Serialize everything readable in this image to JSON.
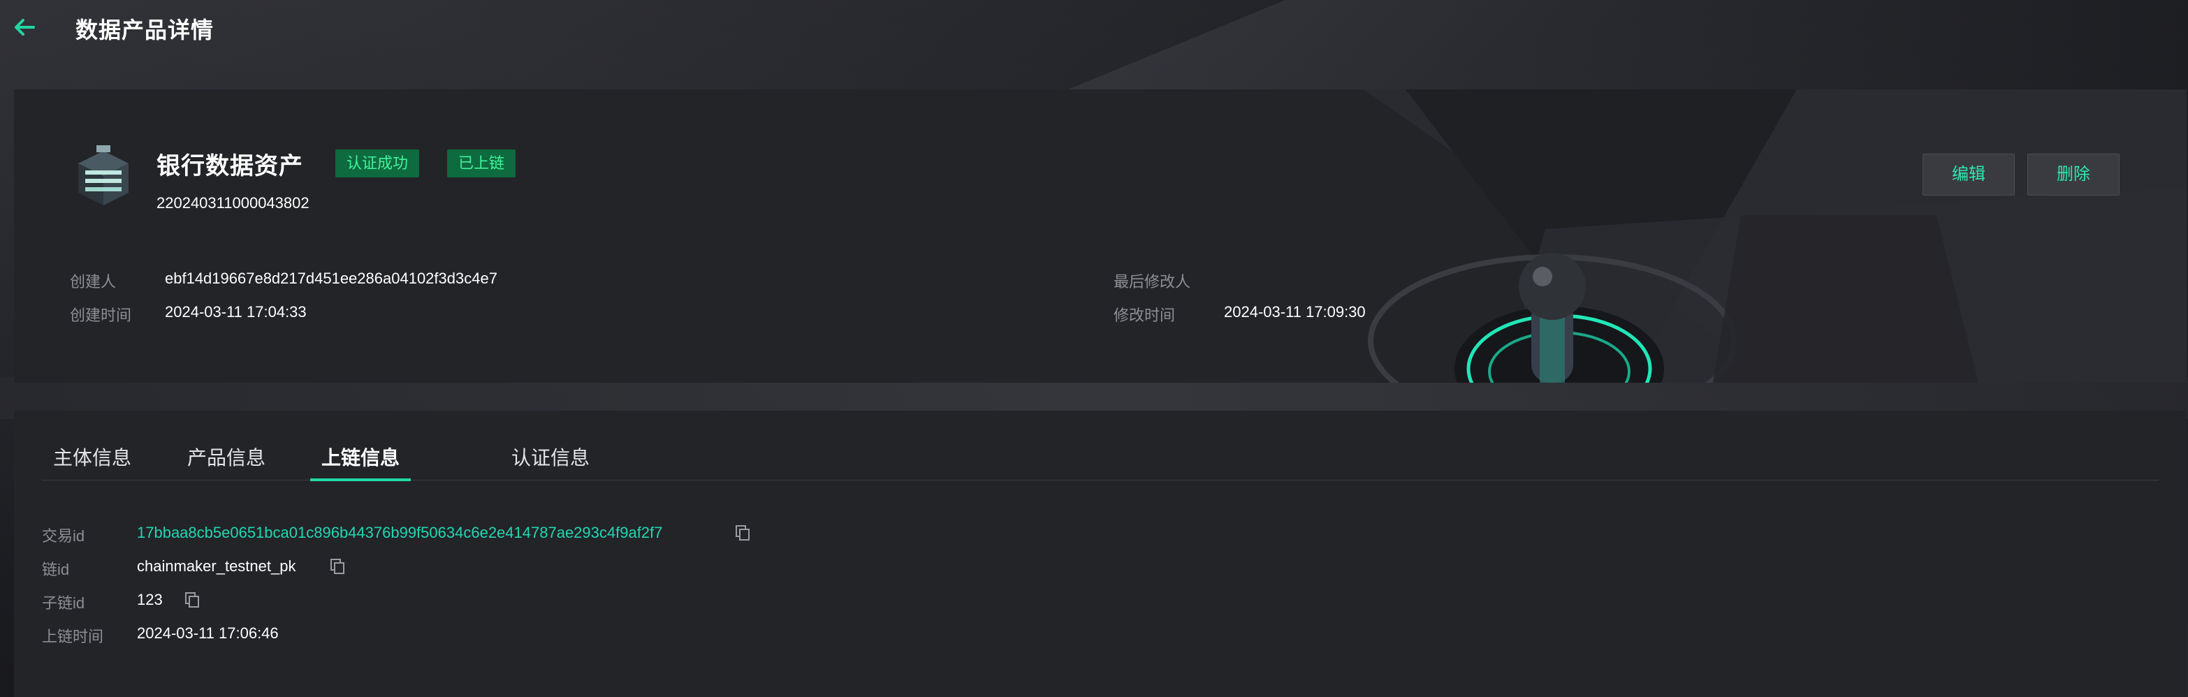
{
  "header": {
    "title": "数据产品详情",
    "back_icon": "arrow-left-icon"
  },
  "colors": {
    "accent": "#21d7a4",
    "badge_bg": "#0e6a3f",
    "badge_text": "#3ff59a",
    "link": "#20d8b2"
  },
  "asset": {
    "name": "银行数据资产",
    "id": "220240311000043802",
    "icon": "data-asset-icon",
    "badges": [
      "认证成功",
      "已上链"
    ],
    "meta": {
      "creator_label": "创建人",
      "creator_value": "ebf14d19667e8d217d451ee286a04102f3d3c4e7",
      "created_time_label": "创建时间",
      "created_time_value": "2024-03-11 17:04:33",
      "modifier_label": "最后修改人",
      "modifier_value": "",
      "modified_time_label": "修改时间",
      "modified_time_value": "2024-03-11 17:09:30"
    },
    "actions": {
      "edit_label": "编辑",
      "delete_label": "删除"
    }
  },
  "tabs": [
    {
      "label": "主体信息",
      "active": false
    },
    {
      "label": "产品信息",
      "active": false
    },
    {
      "label": "上链信息",
      "active": true
    },
    {
      "label": "认证信息",
      "active": false
    }
  ],
  "chain_info": {
    "tx_id_label": "交易id",
    "tx_id_value": "17bbaa8cb5e0651bca01c896b44376b99f50634c6e2e414787ae293c4f9af2f7",
    "chain_id_label": "链id",
    "chain_id_value": "chainmaker_testnet_pk",
    "sub_chain_id_label": "子链id",
    "sub_chain_id_value": "123",
    "chain_time_label": "上链时间",
    "chain_time_value": "2024-03-11 17:06:46",
    "copy_icon": "copy-icon"
  }
}
